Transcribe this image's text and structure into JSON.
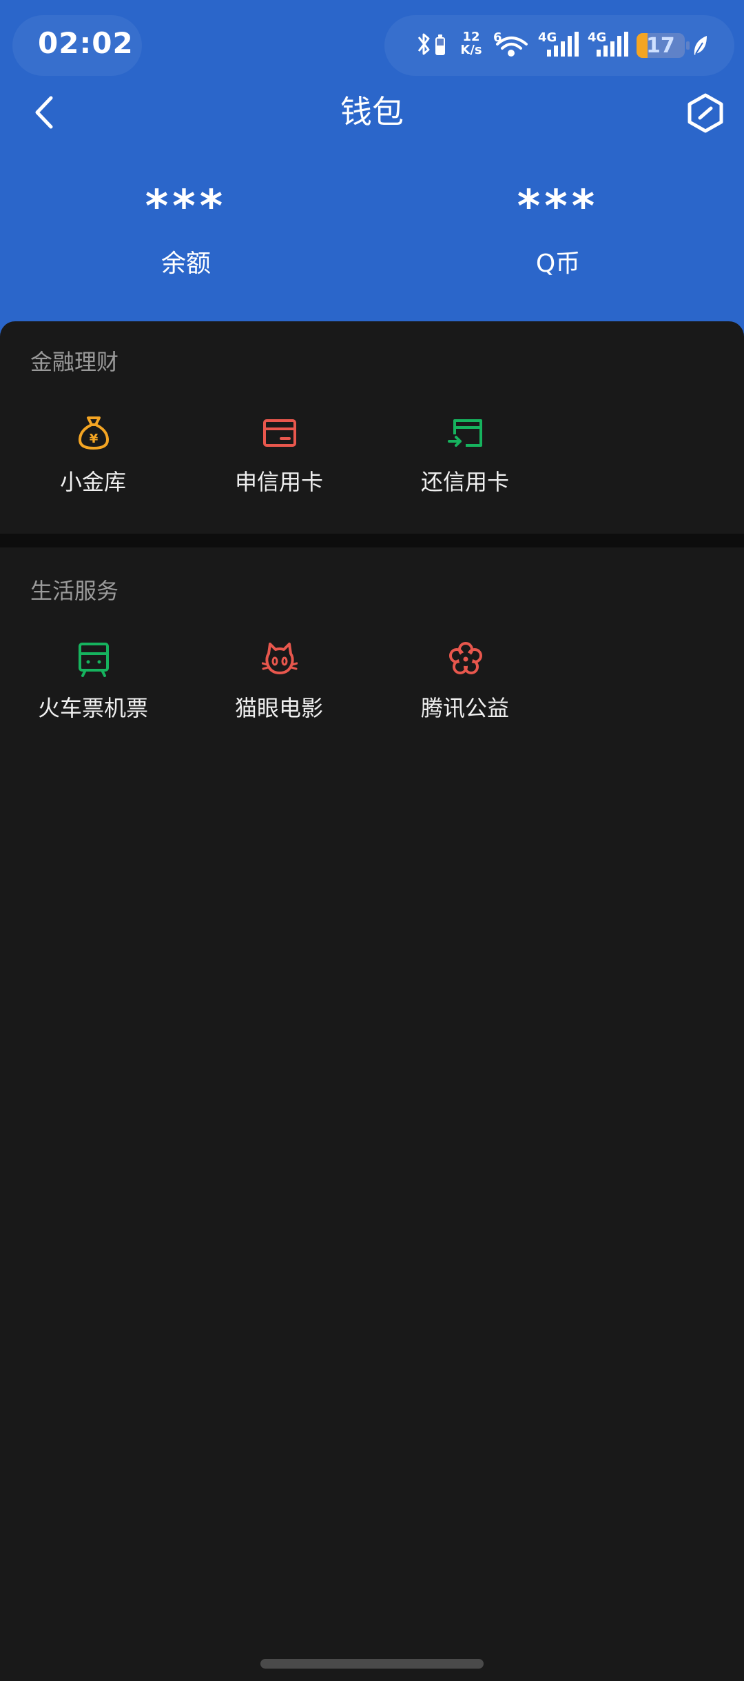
{
  "status_bar": {
    "time": "02:02",
    "net_speed_value": "12",
    "net_speed_unit": "K/s",
    "wifi_label": "6",
    "signal1_label": "4G",
    "signal2_label": "4G",
    "battery": "17"
  },
  "nav": {
    "title": "钱包"
  },
  "summary": {
    "balance_value": "***",
    "balance_label": "余额",
    "qcoin_value": "***",
    "qcoin_label": "Q币"
  },
  "finance": {
    "title": "金融理财",
    "items": [
      {
        "label": "小金库",
        "icon": "money-bag-icon",
        "color": "#F4A523"
      },
      {
        "label": "申信用卡",
        "icon": "credit-card-icon",
        "color": "#E8574D"
      },
      {
        "label": "还信用卡",
        "icon": "card-repay-icon",
        "color": "#16B35E"
      }
    ]
  },
  "life": {
    "title": "生活服务",
    "items": [
      {
        "label": "火车票机票",
        "icon": "train-icon",
        "color": "#16B35E"
      },
      {
        "label": "猫眼电影",
        "icon": "cat-icon",
        "color": "#E8574D"
      },
      {
        "label": "腾讯公益",
        "icon": "flower-icon",
        "color": "#E8574D"
      }
    ]
  }
}
